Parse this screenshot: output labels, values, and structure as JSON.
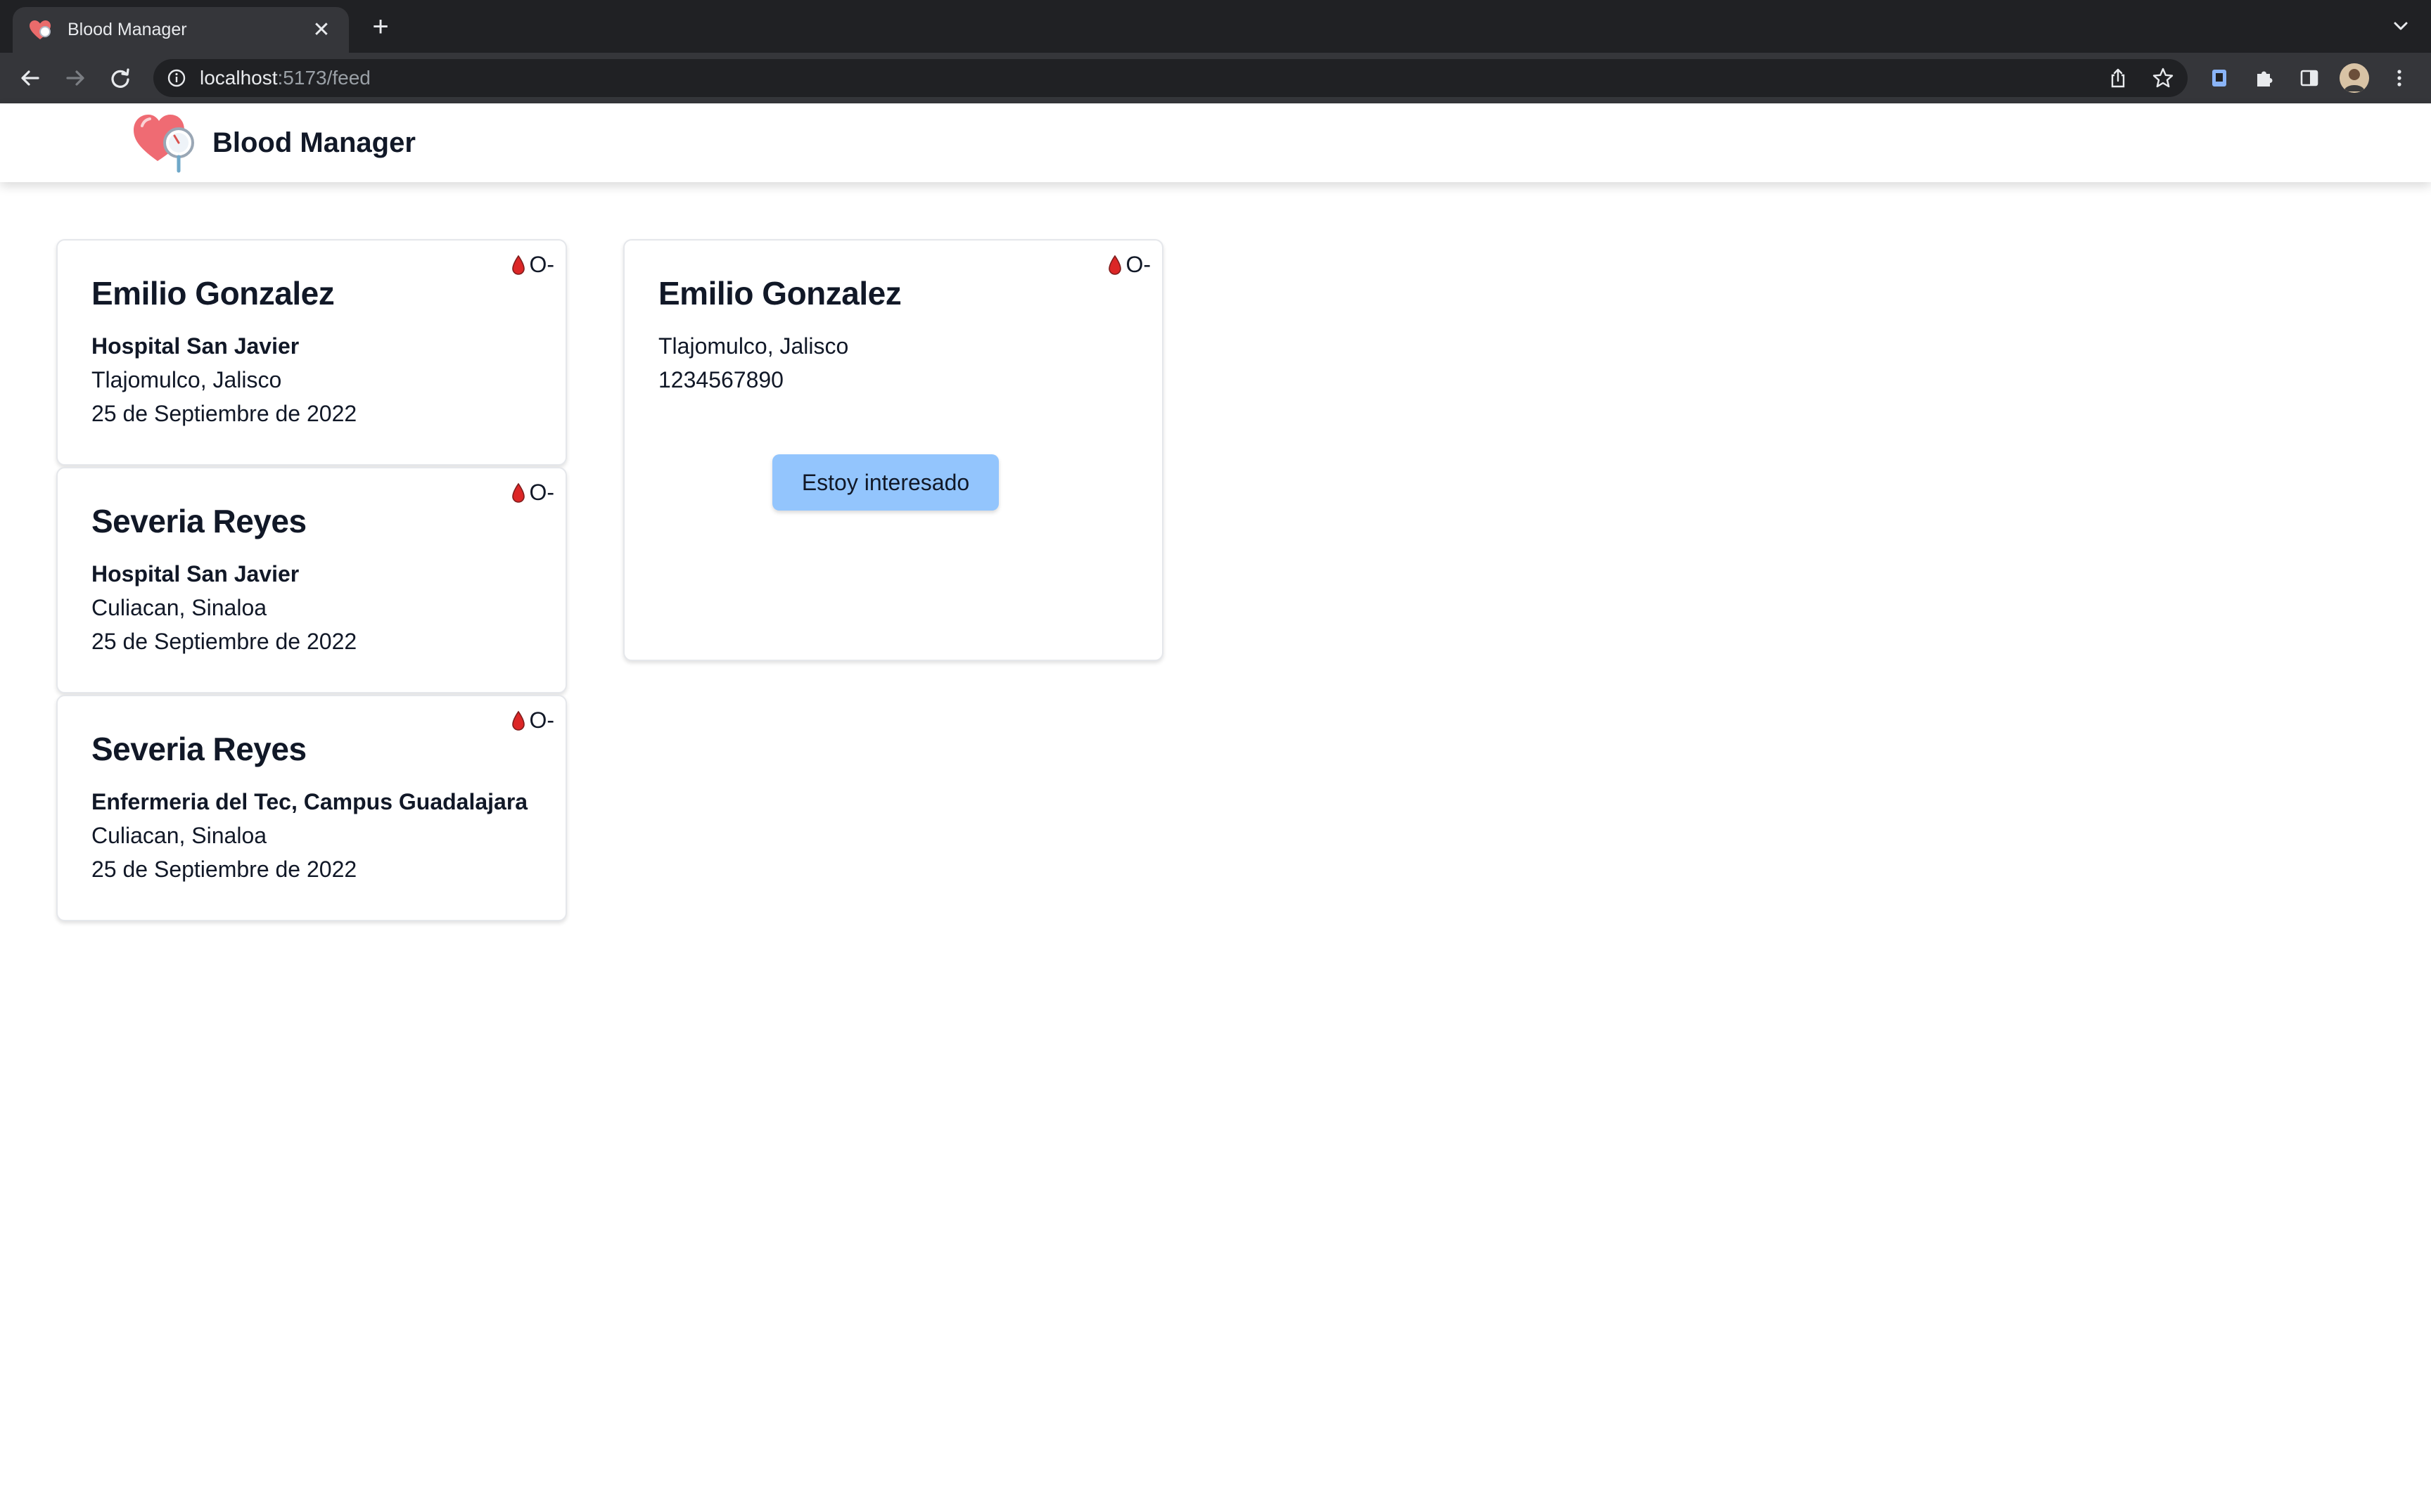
{
  "browser": {
    "tab_title": "Blood Manager",
    "url_host": "localhost",
    "url_path": ":5173/feed"
  },
  "app": {
    "title": "Blood Manager",
    "logo": "heart-stethoscope-logo"
  },
  "feed": {
    "requests": [
      {
        "name": "Emilio Gonzalez",
        "place": "Hospital San Javier",
        "location": "Tlajomulco, Jalisco",
        "date": "25 de Septiembre de 2022",
        "blood_type": "O-"
      },
      {
        "name": "Severia Reyes",
        "place": "Hospital San Javier",
        "location": "Culiacan, Sinaloa",
        "date": "25 de Septiembre de 2022",
        "blood_type": "O-"
      },
      {
        "name": "Severia Reyes",
        "place": "Enfermeria del Tec, Campus Guadalajara",
        "location": "Culiacan, Sinaloa",
        "date": "25 de Septiembre de 2022",
        "blood_type": "O-"
      }
    ]
  },
  "detail": {
    "name": "Emilio Gonzalez",
    "location": "Tlajomulco, Jalisco",
    "phone": "1234567890",
    "blood_type": "O-",
    "button_label": "Estoy interesado"
  },
  "colors": {
    "button": "#93c5fd",
    "blood_drop": "#dc2626",
    "chrome_dark": "#202124"
  }
}
